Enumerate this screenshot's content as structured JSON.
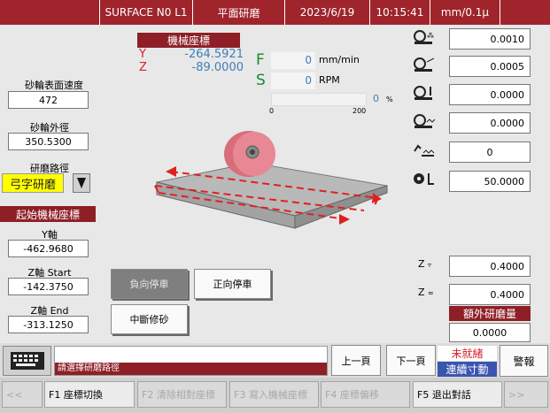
{
  "header": {
    "machine": "SURFACE N0 L1",
    "mode": "平面研磨",
    "date": "2023/6/19",
    "time": "10:15:41",
    "unit": "mm/0.1μ"
  },
  "left": {
    "wheel_speed_label": "砂輪表面速度",
    "wheel_speed_value": "472",
    "wheel_dia_label": "砂輪外徑",
    "wheel_dia_value": "350.5300",
    "path_label": "研磨路徑",
    "path_value": "弓字研磨",
    "start_coord_title": "起始機械座標",
    "y_axis_label": "Y軸",
    "y_axis_value": "-462.9680",
    "z_start_label": "Z軸 Start",
    "z_start_value": "-142.3750",
    "z_end_label": "Z軸 End",
    "z_end_value": "-313.1250"
  },
  "machine_coords": {
    "title": "機械座標",
    "y_axis": "Y",
    "y_value": "-264.5921",
    "z_axis": "Z",
    "z_value": "-89.0000"
  },
  "feed": {
    "f_label": "F",
    "f_value": "0",
    "f_unit": "mm/min",
    "s_label": "S",
    "s_value": "0",
    "s_unit": "RPM",
    "bar_value": "0",
    "bar_unit": "%",
    "bar_percent": 0,
    "bar_min": "0",
    "bar_max": "200"
  },
  "right": {
    "row1_value": "0.0010",
    "row2_value": "0.0005",
    "row3_value": "0.0000",
    "row4_value": "0.0000",
    "row5_value": "0",
    "row6_value": "50.0000",
    "z1_label": "Z",
    "z1_value": "0.4000",
    "z2_label": "Z",
    "z2_value": "0.4000",
    "extra_title": "額外研磨量",
    "extra_value": "0.0000"
  },
  "buttons": {
    "neg_stop": "負向停車",
    "pos_stop": "正向停車",
    "interrupt": "中斷修砂",
    "prev_page": "上一頁",
    "next_page": "下一頁",
    "status1": "未就緒",
    "status2": "連續寸動",
    "alarm": "警報"
  },
  "message": "請選擇研磨路徑",
  "fkeys": {
    "left_arrow": "<<",
    "f1": "F1 座標切換",
    "f2": "F2 清除相對座標",
    "f3": "F3 寫入機械座標",
    "f4": "F4 座標偏移",
    "f5": "F5 退出對話",
    "right_arrow": ">>"
  },
  "colors": {
    "header_bg": "#a0242c",
    "axis_red": "#d8202a",
    "value_blue": "#3e7dbb",
    "feed_green": "#178a2e",
    "path_yellow": "#ffff00"
  }
}
